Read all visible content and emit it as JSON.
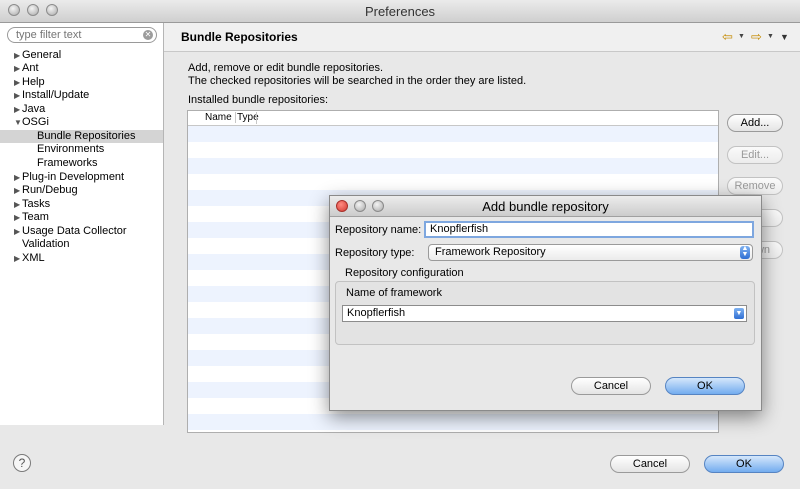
{
  "window": {
    "title": "Preferences"
  },
  "filter": {
    "placeholder": "type filter text"
  },
  "tree": {
    "items": [
      {
        "label": "General",
        "expandable": true
      },
      {
        "label": "Ant",
        "expandable": true
      },
      {
        "label": "Help",
        "expandable": true
      },
      {
        "label": "Install/Update",
        "expandable": true
      },
      {
        "label": "Java",
        "expandable": true
      },
      {
        "label": "OSGi",
        "expandable": true,
        "expanded": true
      },
      {
        "label": "Bundle Repositories",
        "child": true,
        "selected": true
      },
      {
        "label": "Environments",
        "child": true
      },
      {
        "label": "Frameworks",
        "child": true
      },
      {
        "label": "Plug-in Development",
        "expandable": true
      },
      {
        "label": "Run/Debug",
        "expandable": true
      },
      {
        "label": "Tasks",
        "expandable": true
      },
      {
        "label": "Team",
        "expandable": true
      },
      {
        "label": "Usage Data Collector",
        "expandable": true
      },
      {
        "label": "Validation",
        "expandable": false
      },
      {
        "label": "XML",
        "expandable": true
      }
    ]
  },
  "page": {
    "title": "Bundle Repositories",
    "description_line1": "Add, remove or edit bundle repositories.",
    "description_line2": "The checked repositories will be searched in the order they are listed.",
    "installed_label": "Installed bundle repositories:",
    "table": {
      "col_name": "Name",
      "col_type": "Type"
    },
    "buttons": {
      "add": "Add...",
      "edit": "Edit...",
      "remove": "Remove",
      "down_partial": "wn"
    }
  },
  "footer": {
    "help_icon": "?",
    "cancel": "Cancel",
    "ok": "OK"
  },
  "dialog": {
    "title": "Add bundle repository",
    "repo_name_label": "Repository name:",
    "repo_name_value": "Knopflerfish",
    "repo_type_label": "Repository type:",
    "repo_type_value": "Framework Repository",
    "config_group_label": "Repository configuration",
    "framework_label": "Name of framework",
    "framework_value": "Knopflerfish",
    "cancel": "Cancel",
    "ok": "OK"
  },
  "colors": {
    "accent": "#73acef",
    "selection": "#d4d4d4",
    "table_alt": "#edf3fe",
    "dialog_close": "#e0443e"
  }
}
